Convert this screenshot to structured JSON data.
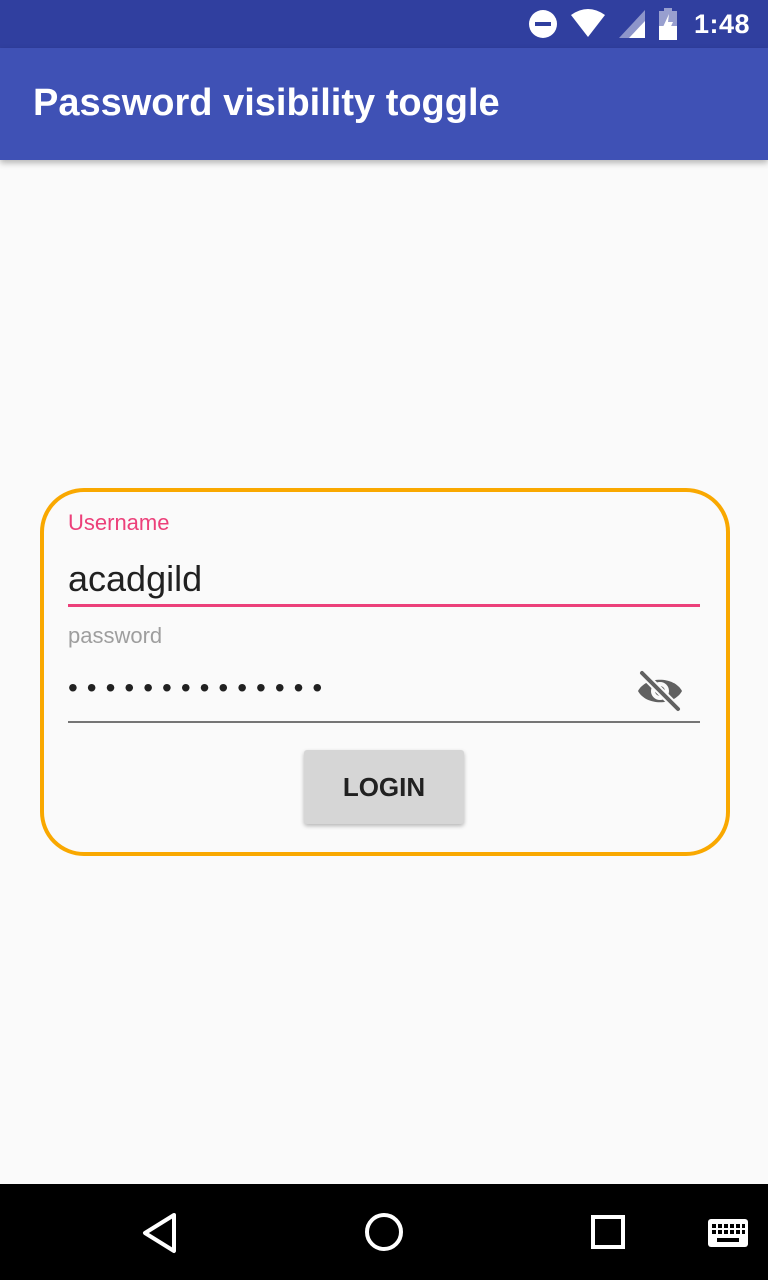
{
  "status_bar": {
    "time": "1:48",
    "icons": [
      "do-not-disturb-icon",
      "wifi-icon",
      "cell-signal-icon",
      "battery-charging-icon"
    ]
  },
  "app_bar": {
    "title": "Password visibility toggle",
    "color": "#3f51b5"
  },
  "form": {
    "border_color": "#f9a800",
    "username": {
      "label": "Username",
      "value": "acadgild",
      "accent_color": "#ec407a"
    },
    "password": {
      "placeholder": "password",
      "masked_value": "••••••••••••••",
      "toggle_icon": "visibility-off-icon"
    },
    "login_button": {
      "label": "LOGIN"
    }
  },
  "nav_bar": {
    "icons": [
      "back-icon",
      "home-icon",
      "recents-icon",
      "keyboard-icon"
    ]
  }
}
